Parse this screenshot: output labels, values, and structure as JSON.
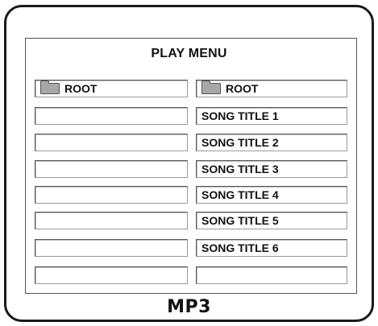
{
  "device": {
    "brand_label": "MP3"
  },
  "play_menu": {
    "title": "PLAY MENU",
    "left_column": {
      "folder_label": "ROOT",
      "items": [
        "",
        "",
        "",
        "",
        "",
        "",
        ""
      ]
    },
    "right_column": {
      "folder_label": "ROOT",
      "items": [
        "SONG TITLE 1",
        "SONG TITLE 2",
        "SONG TITLE 3",
        "SONG TITLE 4",
        "SONG TITLE 5",
        "SONG TITLE 6",
        ""
      ]
    }
  },
  "icons": {
    "folder": "folder-icon"
  },
  "colors": {
    "folder_fill": "#a8a8a8",
    "frame": "#1a1a1a"
  }
}
